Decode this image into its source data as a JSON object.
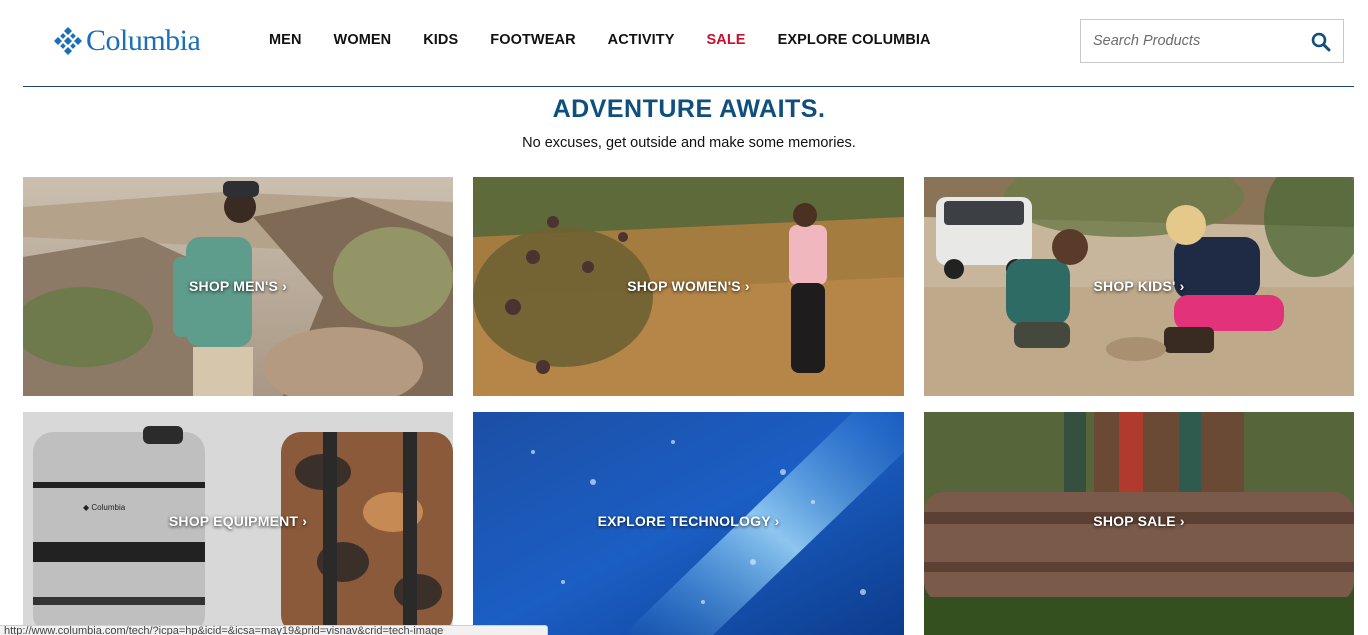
{
  "brand": {
    "name": "Columbia",
    "color": "#1a6fb8"
  },
  "nav": {
    "items": [
      {
        "label": "MEN"
      },
      {
        "label": "WOMEN"
      },
      {
        "label": "KIDS"
      },
      {
        "label": "FOOTWEAR"
      },
      {
        "label": "ACTIVITY"
      },
      {
        "label": "SALE",
        "color": "#c8102e"
      },
      {
        "label": "EXPLORE COLUMBIA"
      }
    ]
  },
  "search": {
    "placeholder": "Search Products",
    "value": "",
    "icon": "search-icon"
  },
  "hero": {
    "title": "ADVENTURE AWAITS.",
    "subtitle": "No excuses, get outside and make some memories."
  },
  "tiles": [
    {
      "label": "SHOP MEN'S ›"
    },
    {
      "label": "SHOP WOMEN'S ›"
    },
    {
      "label": "SHOP KIDS' ›"
    },
    {
      "label": "SHOP EQUIPMENT ›"
    },
    {
      "label": "EXPLORE TECHNOLOGY ›"
    },
    {
      "label": "SHOP SALE ›"
    }
  ],
  "status_bar": {
    "url": "http://www.columbia.com/tech/?icpa=hp&icid=&icsa=may19&prid=visnav&crid=tech-image"
  }
}
